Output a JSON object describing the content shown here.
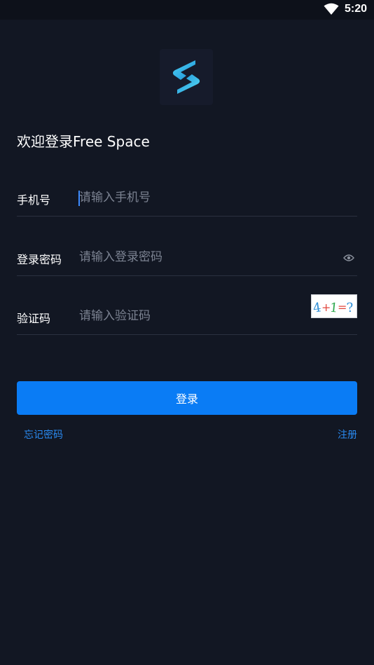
{
  "status_bar": {
    "time": "5:20",
    "wifi_icon": "wifi-icon"
  },
  "app": {
    "logo_icon": "s-logo-icon"
  },
  "welcome": {
    "title": "欢迎登录Free Space"
  },
  "form": {
    "phone": {
      "label": "手机号",
      "placeholder": "请输入手机号",
      "value": ""
    },
    "password": {
      "label": "登录密码",
      "placeholder": "请输入登录密码",
      "value": "",
      "toggle_icon": "eye-icon"
    },
    "captcha": {
      "label": "验证码",
      "placeholder": "请输入验证码",
      "value": ""
    }
  },
  "actions": {
    "login_label": "登录",
    "forgot_password_label": "忘记密码",
    "register_label": "注册"
  },
  "colors": {
    "background": "#121723",
    "accent": "#0a7cf5",
    "link": "#2a8bf2",
    "divider": "#2b3140"
  }
}
